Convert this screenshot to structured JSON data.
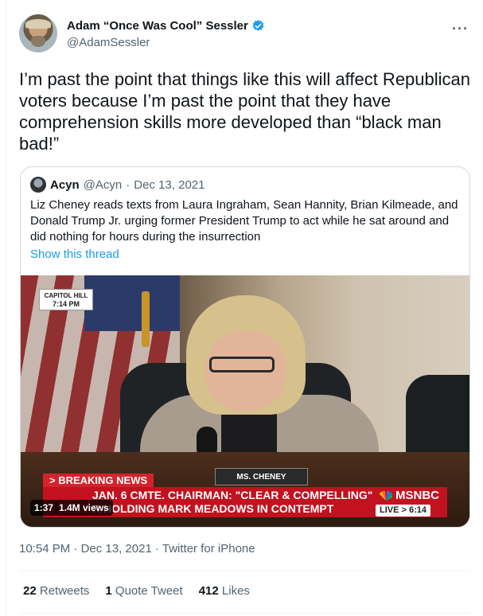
{
  "author": {
    "display_name": "Adam “Once Was Cool” Sessler",
    "handle": "@AdamSessler",
    "verified": true
  },
  "tweet": {
    "text": "I’m past the point that things like this will affect Republican voters because I’m past the point that they have comprehension skills more developed than “black man bad!”",
    "time": "10:54 PM",
    "date": "Dec 13, 2021",
    "source": "Twitter for iPhone",
    "separator": "·"
  },
  "quote": {
    "name": "Acyn",
    "handle": "@Acyn",
    "separator": "·",
    "date": "Dec 13, 2021",
    "text": "Liz Cheney reads texts from Laura Ingraham, Sean Hannity, Brian Kilmeade, and Donald Trump Jr. urging former President Trump to act while he sat around and did nothing for hours during the insurrection",
    "show_thread": "Show this thread"
  },
  "video": {
    "location_tag": "CAPITOL HILL",
    "location_time": "7:14 PM",
    "nameplate": "MS. CHENEY",
    "breaking": "> BREAKING NEWS",
    "chyron_line1": "JAN. 6 CMTE. CHAIRMAN: \"CLEAR & COMPELLING\"",
    "chyron_line2": "R HOLDING MARK MEADOWS IN CONTEMPT",
    "network": "MSNBC",
    "live": "LIVE > 6:14",
    "duration": "1:37",
    "views": "1.4M views"
  },
  "stats": {
    "retweets_count": "22",
    "retweets_label": "Retweets",
    "quotes_count": "1",
    "quotes_label": "Quote Tweet",
    "likes_count": "412",
    "likes_label": "Likes"
  },
  "colors": {
    "accent": "#1d9bf0",
    "text_primary": "#0f1419",
    "text_secondary": "#536471",
    "border": "#cfd9de",
    "chyron_red": "#c2121f"
  }
}
